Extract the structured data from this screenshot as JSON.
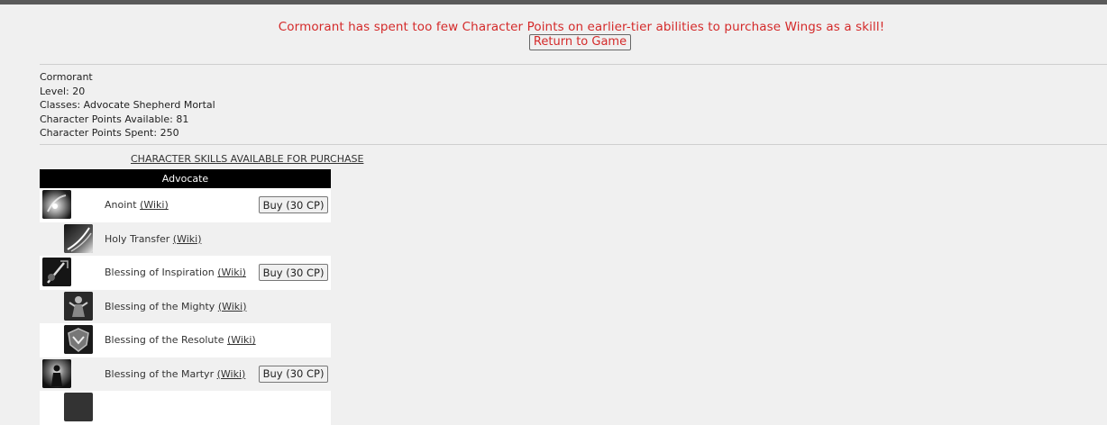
{
  "error": {
    "message": "Cormorant has spent too few Character Points on earlier-tier abilities to purchase Wings as a skill!",
    "return_label": "Return to Game"
  },
  "character": {
    "name": "Cormorant",
    "level_label": "Level:",
    "level": "20",
    "classes_label": "Classes:",
    "classes": "Advocate Shepherd Mortal",
    "cp_available_label": "Character Points Available:",
    "cp_available": "81",
    "cp_spent_label": "Character Points Spent:",
    "cp_spent": "250"
  },
  "skills_section": {
    "title": "CHARACTER SKILLS AVAILABLE FOR PURCHASE",
    "class_name": "Advocate",
    "wiki_label": "(Wiki)",
    "items": [
      {
        "name": "Anoint",
        "icon": "anoint-icon",
        "buy_label": "Buy (30 CP)"
      },
      {
        "name": "Holy Transfer",
        "icon": "holy-transfer-icon",
        "buy_label": ""
      },
      {
        "name": "Blessing of Inspiration",
        "icon": "blessing-of-inspiration-icon",
        "buy_label": "Buy (30 CP)"
      },
      {
        "name": "Blessing of the Mighty",
        "icon": "blessing-of-the-mighty-icon",
        "buy_label": ""
      },
      {
        "name": "Blessing of the Resolute",
        "icon": "blessing-of-the-resolute-icon",
        "buy_label": ""
      },
      {
        "name": "Blessing of the Martyr",
        "icon": "blessing-of-the-martyr-icon",
        "buy_label": "Buy (30 CP)"
      }
    ]
  },
  "colors": {
    "error_text": "#d42a2a",
    "background": "#f0f0f0",
    "class_header": "#000000"
  }
}
